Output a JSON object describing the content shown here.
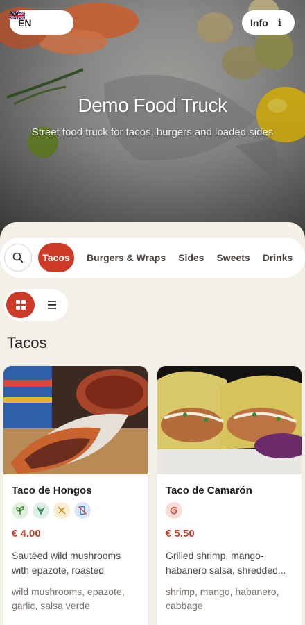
{
  "header": {
    "language": {
      "code": "EN",
      "flag_icon": "uk-flag-icon"
    },
    "info_label": "Info",
    "title": "Demo Food Truck",
    "subtitle": "Street food truck for tacos, burgers and loaded sides"
  },
  "categories": {
    "tabs": [
      {
        "label": "Tacos",
        "active": true
      },
      {
        "label": "Burgers & Wraps",
        "active": false
      },
      {
        "label": "Sides",
        "active": false
      },
      {
        "label": "Sweets",
        "active": false
      },
      {
        "label": "Drinks",
        "active": false
      }
    ]
  },
  "view_toggle": {
    "selected": "grid"
  },
  "section": {
    "title": "Tacos"
  },
  "products": [
    {
      "name": "Taco de Hongos",
      "price": "€ 4.00",
      "description": "Sautéed wild mushrooms with epazote, roasted garlic,...",
      "ingredients": "wild mushrooms, epazote, garlic, salsa verde",
      "badges": [
        "vegan-leaf-icon",
        "vegetarian-icon",
        "gluten-free-icon",
        "no-phone-icon"
      ]
    },
    {
      "name": "Taco de Camarón",
      "price": "€ 5.50",
      "description": "Grilled shrimp, mango-habanero salsa, shredded...",
      "ingredients": "shrimp, mango, habanero, cabbage",
      "badges": [
        "shellfish-icon"
      ]
    }
  ],
  "colors": {
    "accent": "#cc3a28",
    "background": "#f3f0e8"
  }
}
